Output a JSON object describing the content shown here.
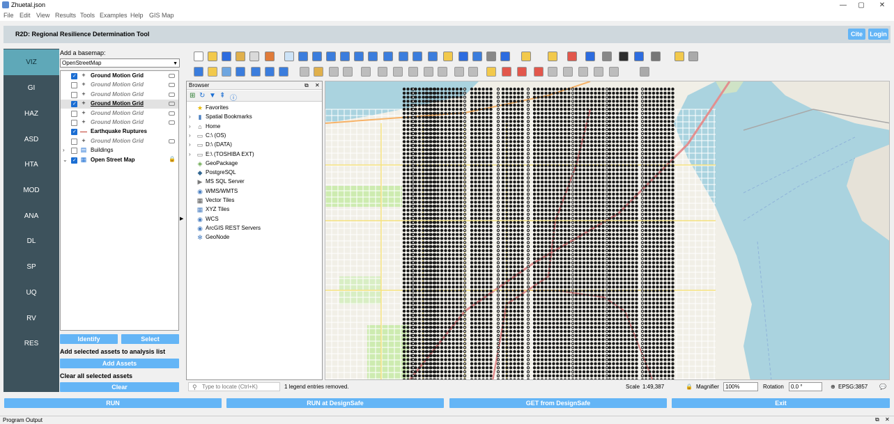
{
  "window": {
    "title": "Zhuetal.json",
    "controls": [
      "—",
      "▢",
      "✕"
    ]
  },
  "menubar": [
    "File",
    "Edit",
    "View",
    "Results",
    "Tools",
    "Examples",
    "Help",
    "GIS Map"
  ],
  "header": {
    "title": "R2D: Regional Resilience Determination Tool",
    "cite_label": "Cite",
    "login_label": "Login"
  },
  "nav": {
    "items": [
      "VIZ",
      "GI",
      "HAZ",
      "ASD",
      "HTA",
      "MOD",
      "ANA",
      "DL",
      "SP",
      "UQ",
      "RV",
      "RES"
    ],
    "active": "VIZ"
  },
  "basemap": {
    "label": "Add a basemap:",
    "value": "OpenStreetMap"
  },
  "layers": [
    {
      "name": "Ground Motion Grid",
      "checked": true,
      "style": "bold",
      "expander": "",
      "symbol": "+"
    },
    {
      "name": "Ground Motion Grid",
      "checked": false,
      "style": "dim",
      "expander": "",
      "symbol": "+"
    },
    {
      "name": "Ground Motion Grid",
      "checked": false,
      "style": "dim",
      "expander": "",
      "symbol": "+"
    },
    {
      "name": "Ground Motion Grid",
      "checked": true,
      "style": "selected",
      "expander": "",
      "symbol": "+"
    },
    {
      "name": "Ground Motion Grid",
      "checked": false,
      "style": "dim",
      "expander": "",
      "symbol": "+"
    },
    {
      "name": "Ground Motion Grid",
      "checked": false,
      "style": "dim",
      "expander": "",
      "symbol": "+"
    },
    {
      "name": "Earthquake Ruptures",
      "checked": true,
      "style": "bold",
      "expander": "",
      "symbol": "line"
    },
    {
      "name": "Ground Motion Grid",
      "checked": false,
      "style": "dim",
      "expander": "",
      "symbol": "+"
    },
    {
      "name": "Buildings",
      "checked": false,
      "style": "plain",
      "expander": "›",
      "symbol": "▤"
    },
    {
      "name": "Open Street Map",
      "checked": true,
      "style": "bold",
      "expander": "⌄",
      "symbol": "▦"
    }
  ],
  "left_actions": {
    "identify_label": "Identify",
    "select_label": "Select",
    "add_heading": "Add selected assets to analysis list",
    "add_button": "Add Assets",
    "clear_heading": "Clear all selected assets",
    "clear_button": "Clear"
  },
  "browser": {
    "title": "Browser",
    "items": [
      {
        "name": "Favorites",
        "icon": "★",
        "expander": "",
        "color": "#e6b800"
      },
      {
        "name": "Spatial Bookmarks",
        "icon": "▮",
        "expander": "›",
        "color": "#4a7fc1"
      },
      {
        "name": "Home",
        "icon": "⌂",
        "expander": "›",
        "color": "#555555"
      },
      {
        "name": "C:\\ (OS)",
        "icon": "▭",
        "expander": "›",
        "color": "#666666"
      },
      {
        "name": "D:\\ (DATA)",
        "icon": "▭",
        "expander": "›",
        "color": "#666666"
      },
      {
        "name": "E:\\ (TOSHIBA EXT)",
        "icon": "▭",
        "expander": "›",
        "color": "#666666"
      },
      {
        "name": "GeoPackage",
        "icon": "◈",
        "expander": "",
        "color": "#6aa84f"
      },
      {
        "name": "PostgreSQL",
        "icon": "◆",
        "expander": "",
        "color": "#336791"
      },
      {
        "name": "MS SQL Server",
        "icon": "▶",
        "expander": "",
        "color": "#7a7a7a"
      },
      {
        "name": "WMS/WMTS",
        "icon": "◉",
        "expander": "",
        "color": "#4a7fc1"
      },
      {
        "name": "Vector Tiles",
        "icon": "▦",
        "expander": "",
        "color": "#555555"
      },
      {
        "name": "XYZ Tiles",
        "icon": "▦",
        "expander": "",
        "color": "#4a7fc1"
      },
      {
        "name": "WCS",
        "icon": "◉",
        "expander": "",
        "color": "#4a7fc1"
      },
      {
        "name": "ArcGIS REST Servers",
        "icon": "◉",
        "expander": "",
        "color": "#4a7fc1"
      },
      {
        "name": "GeoNode",
        "icon": "✻",
        "expander": "",
        "color": "#4a7fc1"
      }
    ]
  },
  "status": {
    "locate_placeholder": "Type to locate (Ctrl+K)",
    "message": "1 legend entries removed.",
    "scale_label": "Scale",
    "scale_value": "1:49,387",
    "magnifier_label": "Magnifier",
    "magnifier_value": "100%",
    "rotation_label": "Rotation",
    "rotation_value": "0.0 °",
    "crs": "EPSG:3857"
  },
  "bottom_buttons": [
    "RUN",
    "RUN at DesignSafe",
    "GET from DesignSafe",
    "Exit"
  ],
  "program_output": {
    "label": "Program Output"
  },
  "colors": {
    "accent": "#64b5f6",
    "nav_bg": "#3d525c",
    "nav_active": "#5fa8b8",
    "header_bg": "#cfd8dd",
    "water": "#aad3df",
    "land": "#f1efe7"
  }
}
